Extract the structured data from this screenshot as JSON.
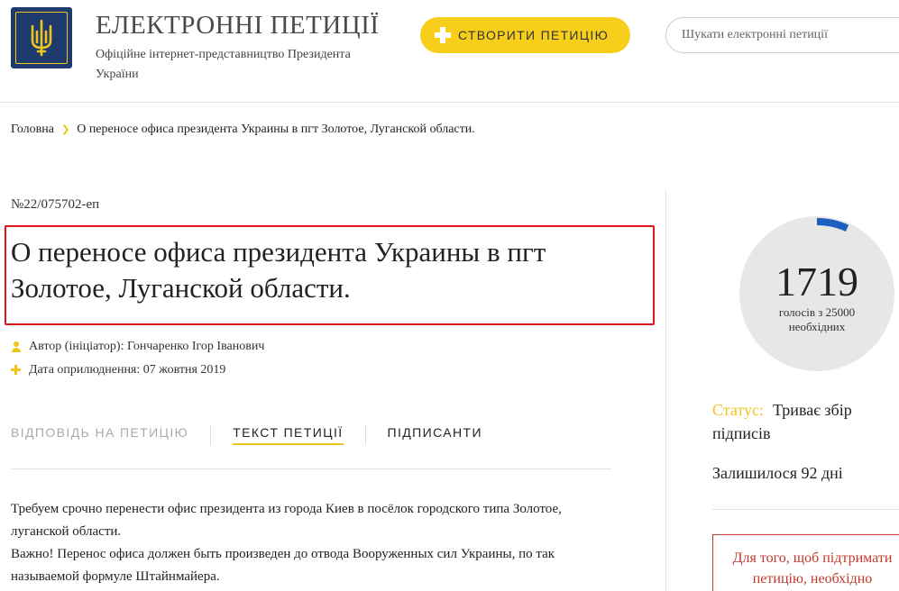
{
  "header": {
    "title": "ЕЛЕКТРОННІ ПЕТИЦІЇ",
    "subtitle": "Офіційне інтернет-представництво Президента України",
    "create_button": "СТВОРИТИ ПЕТИЦІЮ",
    "search_placeholder": "Шукати електронні петиції"
  },
  "breadcrumb": {
    "home": "Головна",
    "current": "О переносе офиса президента Украины в пгт Золотое, Луганской области."
  },
  "petition": {
    "number": "№22/075702-еп",
    "title": "О переносе офиса президента Украины в пгт Золотое, Луганской области.",
    "author_label": "Автор (ініціатор):",
    "author": "Гончаренко Ігор Іванович",
    "date_label": "Дата оприлюднення:",
    "date": "07 жовтня 2019",
    "text_line1": "Требуем срочно перенести офис президента из города Киев в посёлок городского типа Золотое, луганской области.",
    "text_line2": "Важно! Перенос офиса должен быть произведен до отвода Вооруженных сил Украины, по так называемой формуле Штайнмайера."
  },
  "tabs": [
    {
      "label": "ВІДПОВІДЬ НА ПЕТИЦІЮ"
    },
    {
      "label": "ТЕКСТ ПЕТИЦІЇ"
    },
    {
      "label": "ПІДПИСАНТИ"
    }
  ],
  "sidebar": {
    "votes": 1719,
    "votes_needed": 25000,
    "votes_caption": "голосів з 25000 необхідних",
    "status_label": "Статус:",
    "status_value": "Триває збір підписів",
    "remaining": "Залишилося 92 дні",
    "notice": "Для того, щоб підтримати петицію, необхідно"
  },
  "colors": {
    "accent_yellow": "#f7cf1b",
    "logo_blue": "#1f3a6d",
    "progress_blue": "#1f5fbf",
    "highlight_red": "#e0141e"
  }
}
